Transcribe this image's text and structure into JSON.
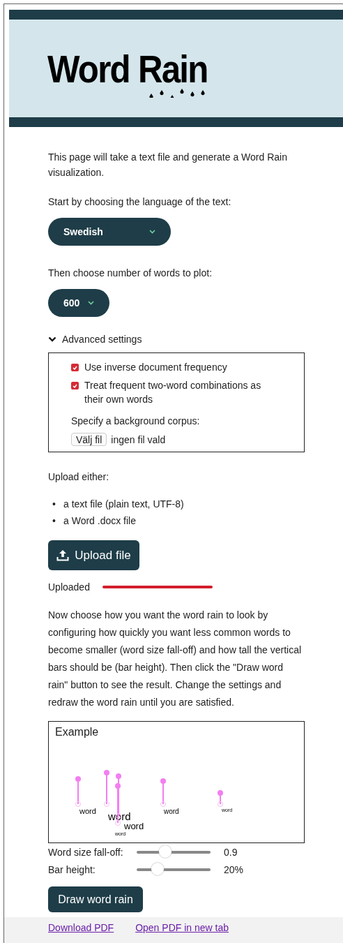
{
  "header": {
    "logo": "Word Rain"
  },
  "intro": "This page will take a text file and generate a Word Rain visualization.",
  "language": {
    "label": "Start by choosing the language of the text:",
    "value": "Swedish"
  },
  "word_count": {
    "label": "Then choose number of words to plot:",
    "value": "600"
  },
  "advanced": {
    "title": "Advanced settings",
    "expanded": true,
    "options": [
      {
        "label": "Use inverse document frequency",
        "checked": true
      },
      {
        "label": "Treat frequent two-word combinations as their own words",
        "checked": true
      }
    ],
    "corpus_label": "Specify a background corpus:",
    "file_button": "Välj fil",
    "file_status": "ingen fil vald"
  },
  "upload": {
    "label": "Upload either:",
    "items": [
      {
        "marker": "•",
        "text": "a text file (plain text, UTF-8)"
      },
      {
        "marker": "•",
        "text": "a Word .docx file"
      }
    ],
    "button": "Upload file",
    "status": "Uploaded"
  },
  "instructions": "Now choose how you want the word rain to look by configuring how quickly you want less common words to become smaller (word size fall-off) and how tall the vertical bars should be (bar height). Then click the \"Draw word rain\" button to see the result. Change the settings and redraw the word rain until you are satisfied.",
  "example": {
    "title": "Example",
    "words": [
      "word",
      "word",
      "word",
      "word",
      "word",
      "word"
    ]
  },
  "sliders": [
    {
      "label": "Word size fall-off:",
      "level": 0.39,
      "reading": "0.9"
    },
    {
      "label": "Bar height:",
      "level": 0.28,
      "reading": "20%"
    }
  ],
  "draw_button": "Draw word rain",
  "links": [
    "Download PDF",
    "Open PDF in new tab"
  ]
}
